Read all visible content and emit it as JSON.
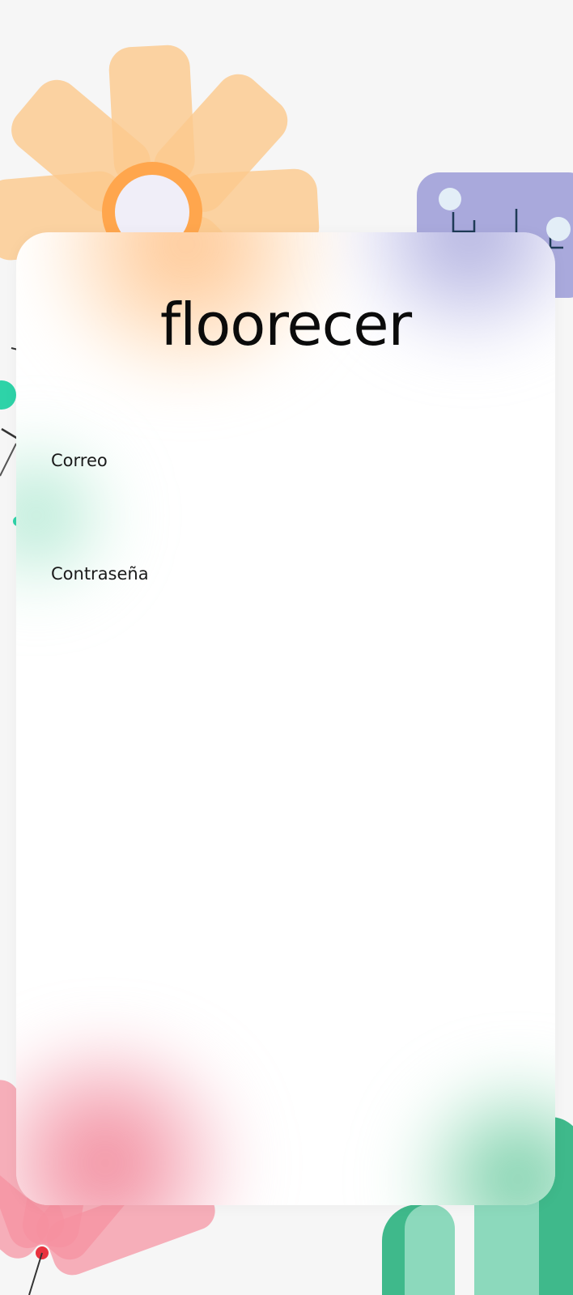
{
  "app": {
    "logo_text": "floorecer"
  },
  "login_form": {
    "email_label": "Correo",
    "email_value": "",
    "password_label": "Contraseña",
    "password_value": ""
  },
  "colors": {
    "background": "#f6f6f6",
    "card": "#ffffff",
    "orange_petal": "#fbc98e",
    "orange_ring": "#ffa64d",
    "purple_block": "#a9a9dc",
    "teal_accent": "#2ed3a8",
    "pink_petal": "#f6909f",
    "green_leaf": "#3fb98b",
    "light_green_leaf": "#8cd9bc"
  }
}
